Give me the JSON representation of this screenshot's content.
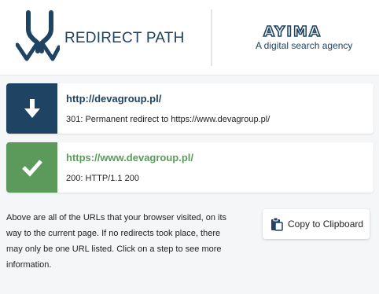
{
  "header": {
    "brand_name": "REDIRECT PATH",
    "partner_name": "AYIMA",
    "partner_tagline": "A digital search agency",
    "brand_color": "#1f4363"
  },
  "hops": [
    {
      "url": "http://devagroup.pl/",
      "detail": "301: Permanent redirect to https://www.devagroup.pl/",
      "icon": "arrow-down-icon",
      "color": "#1f4363"
    },
    {
      "url": "https://www.devagroup.pl/",
      "detail": "200: HTTP/1.1 200",
      "icon": "checkmark-icon",
      "color": "#5c9a5c"
    }
  ],
  "info": {
    "text": "Above are all of the URLs that your browser visited, on its way to the current page. If no redirects took place, there may only be one URL listed. Click on a step to see more information."
  },
  "actions": {
    "copy_label": "Copy to Clipboard",
    "copy_icon": "clipboard-icon"
  }
}
